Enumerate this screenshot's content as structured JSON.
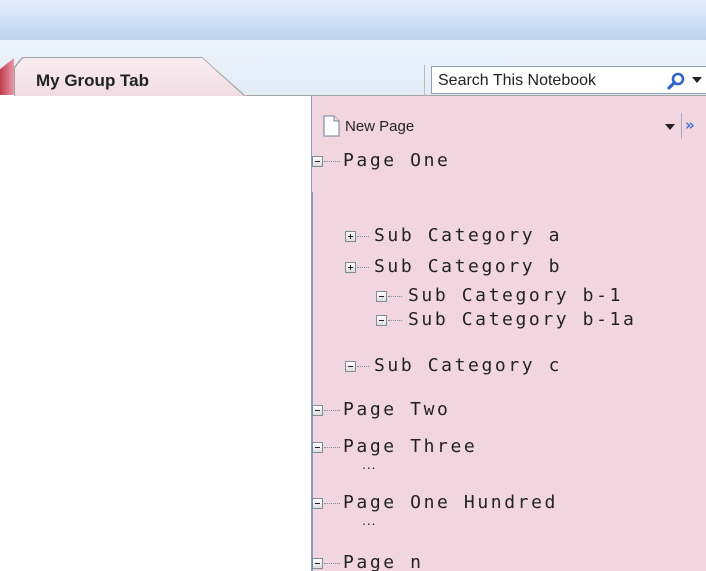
{
  "tabs": [
    {
      "label": "My Group Tab"
    }
  ],
  "search": {
    "value": "Search This Notebook",
    "icon": "search-icon"
  },
  "page_panel": {
    "new_page_label": "New Page",
    "more_icon": "double-chevron-right-icon",
    "pages": [
      {
        "label": "Page One",
        "expanded": true
      },
      {
        "label": "Sub Category a",
        "expanded": false
      },
      {
        "label": "Sub Category b",
        "expanded": false
      },
      {
        "label": "Sub Category b-1",
        "expanded": true
      },
      {
        "label": "Sub Category b-1a",
        "expanded": true
      },
      {
        "label": "Sub Category c",
        "expanded": true
      },
      {
        "label": "Page Two",
        "expanded": true
      },
      {
        "label": "Page Three",
        "expanded": true
      },
      {
        "label": "Page One Hundred",
        "expanded": true
      },
      {
        "label": "Page n",
        "expanded": true
      }
    ],
    "ellipsis": "..."
  },
  "colors": {
    "panel_background": "#f2d6df",
    "tab_background": "#f1dbe3",
    "top_band": "#cfe0f5",
    "accent": "#3a6fd8"
  }
}
